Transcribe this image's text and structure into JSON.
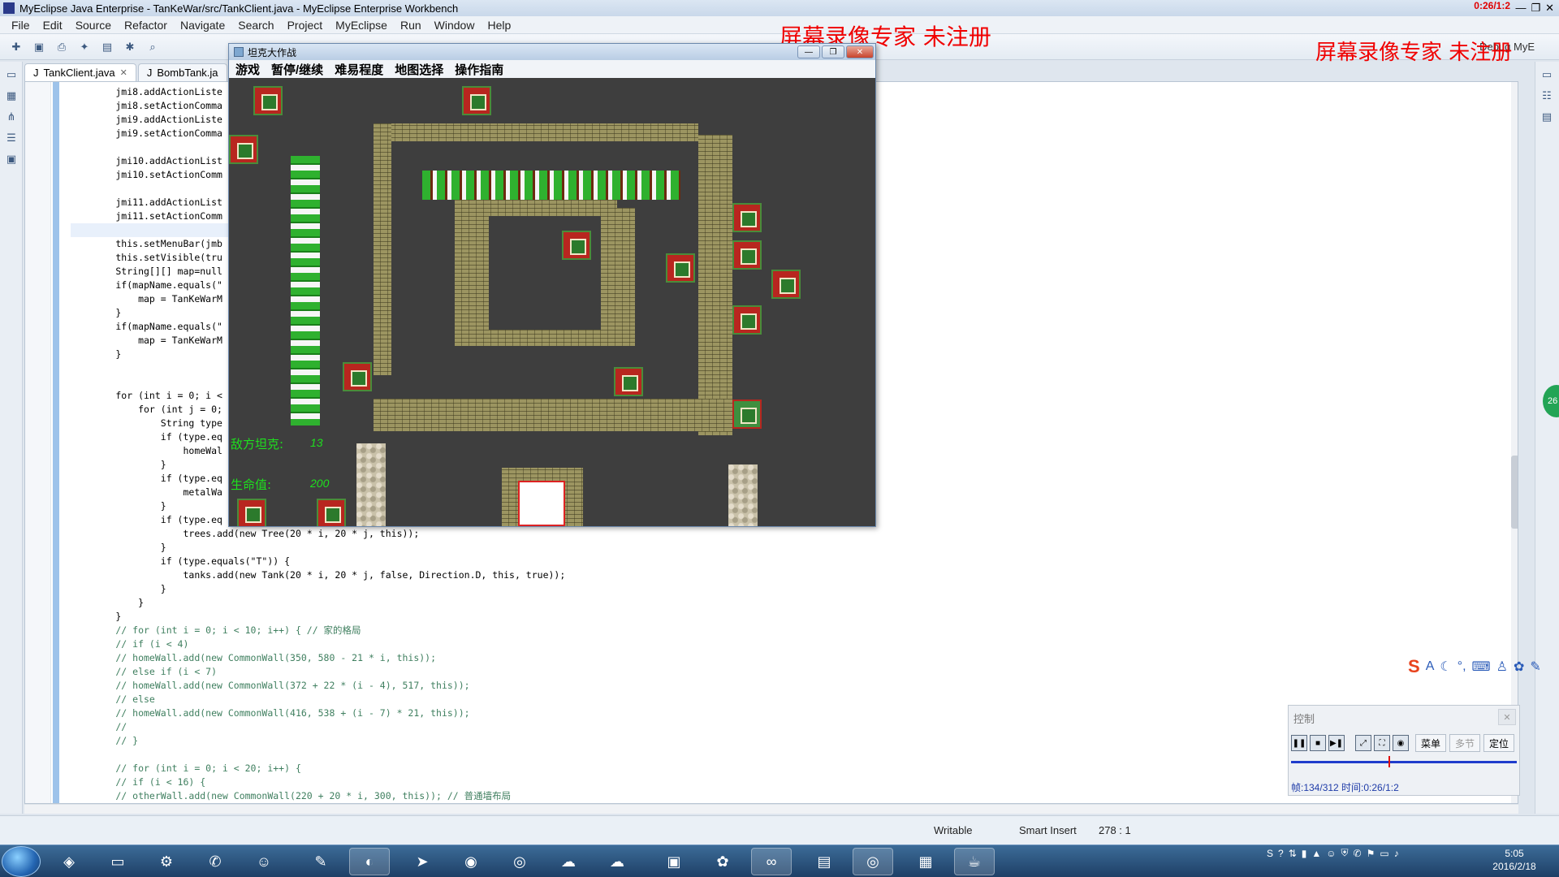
{
  "eclipse": {
    "title": "MyEclipse Java Enterprise - TanKeWar/src/TankClient.java - MyEclipse Enterprise Workbench",
    "menus": [
      "File",
      "Edit",
      "Source",
      "Refactor",
      "Navigate",
      "Search",
      "Project",
      "MyEclipse",
      "Run",
      "Window",
      "Help"
    ],
    "tabs": [
      {
        "label": "TankClient.java",
        "close": "✕"
      },
      {
        "label": "BombTank.ja"
      }
    ],
    "perspective": "Debug  MyE",
    "code_lines": [
      "        jmi8.addActionListe",
      "        jmi8.setActionComma",
      "        jmi9.addActionListe",
      "        jmi9.setActionComma",
      "",
      "        jmi10.addActionList",
      "        jmi10.setActionComm",
      "",
      "        jmi11.addActionList",
      "        jmi11.setActionComm",
      "",
      "        this.setMenuBar(jmb",
      "        this.setVisible(tru",
      "        String[][] map=null",
      "        if(mapName.equals(\"",
      "            map = TanKeWarM",
      "        }",
      "        if(mapName.equals(\"",
      "            map = TanKeWarM",
      "        }",
      "",
      "",
      "        for (int i = 0; i <",
      "            for (int j = 0;",
      "                String type",
      "                if (type.eq",
      "                    homeWal",
      "                }",
      "                if (type.eq",
      "                    metalWa",
      "                }",
      "                if (type.eq",
      "                    trees.add(new Tree(20 * i, 20 * j, this));",
      "                }",
      "                if (type.equals(\"T\")) {",
      "                    tanks.add(new Tank(20 * i, 20 * j, false, Direction.D, this, true));",
      "                }",
      "            }",
      "        }",
      "        // for (int i = 0; i < 10; i++) { // 家的格局",
      "        // if (i < 4)",
      "        // homeWall.add(new CommonWall(350, 580 - 21 * i, this));",
      "        // else if (i < 7)",
      "        // homeWall.add(new CommonWall(372 + 22 * (i - 4), 517, this));",
      "        // else",
      "        // homeWall.add(new CommonWall(416, 538 + (i - 7) * 21, this));",
      "        //",
      "        // }",
      "",
      "        // for (int i = 0; i < 20; i++) {",
      "        // if (i < 16) {",
      "        // otherWall.add(new CommonWall(220 + 20 * i, 300, this)); // 普通墙布局"
    ],
    "status": {
      "mode": "Writable",
      "insert": "Smart Insert",
      "position": "278 : 1"
    }
  },
  "watermark": {
    "text1": "屏幕录像专家 未注册",
    "text2": "屏幕录像专家 未注册",
    "timer": "0:26/1:2"
  },
  "game": {
    "window_title": "坦克大作战",
    "menus": [
      "游戏",
      "暂停/继续",
      "难易程度",
      "地图选择",
      "操作指南"
    ],
    "hud": {
      "enemy_label": "敌方坦克:",
      "enemy_count": "13",
      "life_label": "生命值:",
      "life_value": "200"
    }
  },
  "recorder": {
    "title": "控制",
    "btn_menu": "菜单",
    "btn_chapter": "多节",
    "btn_locate": "定位",
    "info": "帧:134/312 时间:0:26/1:2",
    "progress": 0.43
  },
  "taskbar": {
    "time": "5:05",
    "date": "2016/2/18"
  }
}
